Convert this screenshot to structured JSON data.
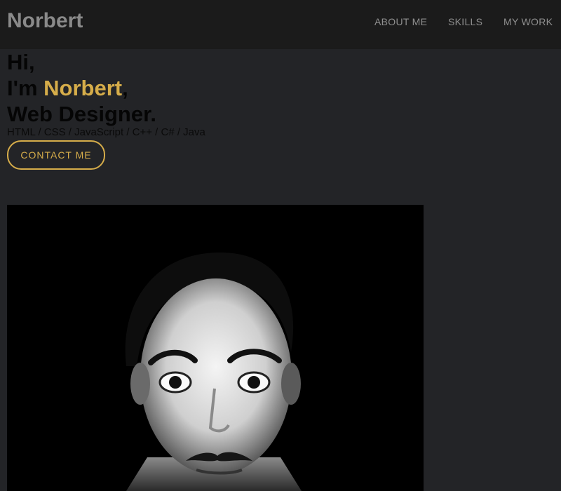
{
  "nav": {
    "brand": "Norbert",
    "links": [
      "ABOUT ME",
      "SKILLS",
      "MY WORK"
    ]
  },
  "hero": {
    "greeting": "Hi,",
    "intro_prefix": "I'm ",
    "name": "Norbert",
    "intro_suffix": ",",
    "role": "Web Designer.",
    "tech": "HTML / CSS / JavaScript / C++ / C# / Java",
    "cta": "CONTACT ME"
  },
  "colors": {
    "accent": "#d6ad4a",
    "background": "#232427",
    "navbar": "#1b1b1b"
  }
}
